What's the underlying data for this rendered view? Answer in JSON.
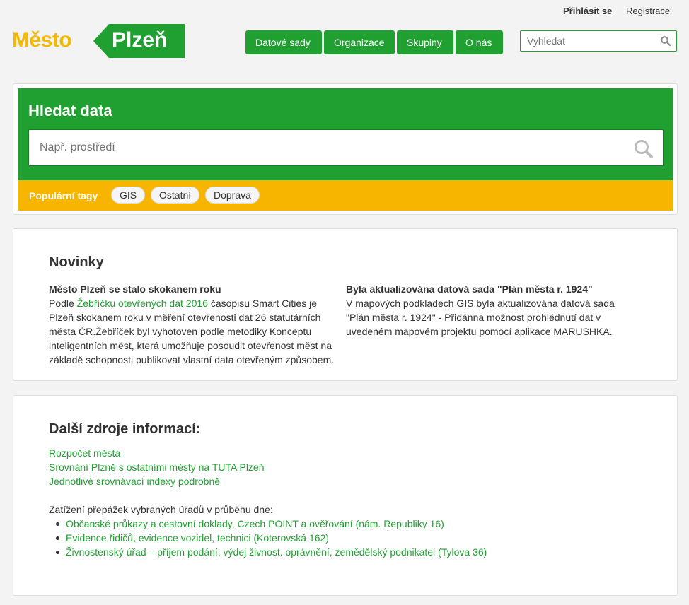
{
  "header": {
    "login_label": "Přihlásit se",
    "register_label": "Registrace",
    "logo": {
      "part1": "Město",
      "part2": "Plzeň"
    },
    "nav": [
      {
        "label": "Datové sady"
      },
      {
        "label": "Organizace"
      },
      {
        "label": "Skupiny"
      },
      {
        "label": "O nás"
      }
    ],
    "search": {
      "placeholder": "Vyhledat",
      "icon": "search-icon"
    }
  },
  "hero": {
    "title": "Hledat data",
    "search": {
      "placeholder": "Např. prostředí",
      "icon": "search-icon"
    },
    "tags_label": "Populární tagy",
    "tags": [
      "GIS",
      "Ostatní",
      "Doprava"
    ]
  },
  "news": {
    "title": "Novinky",
    "items": [
      {
        "title": "Město Plzeň se stalo skokanem roku",
        "text_before_link": "Podle ",
        "link_text": "Žebříčku otevřených dat 2016",
        "text_after_link": " časopisu Smart Cities je Plzeň skokanem roku v měření otevřenosti dat 26 statutárních města ČR.Žebříček byl vyhotoven podle metodiky Konceptu inteligentních měst, která umožňuje posoudit otevřenost měst na základě schopnosti publikovat vlastní data otevřeným způsobem."
      },
      {
        "title": "Byla aktualizována datová sada \"Plán města r. 1924\"",
        "text": "V mapových podkladech GIS byla aktualizována datová sada \"Plán města r. 1924\" - Přidánna možnost prohlédnutí dat v uvedeném mapovém projektu pomocí aplikace MARUSHKA."
      }
    ]
  },
  "resources": {
    "title": "Další zdroje informací:",
    "links": [
      "Rozpočet města",
      "Srovnání Plzně s ostatními městy na TUTA Plzeň",
      "Jednotlivé srovnávací indexy podrobně"
    ],
    "note": "Zatížení přepážek vybraných úřadů v průběhu dne:",
    "offices": [
      "Občanské průkazy a cestovní doklady, Czech POINT a ověřování (nám. Republiky 16)",
      "Evidence řidičů, evidence vozidel, technici (Koterovská 162)",
      "Živnostenský úřad – příjem podání, výdej živnost. oprávnění, zemědělský podnikatel (Tylova 36)"
    ]
  },
  "colors": {
    "brand_green": "#21a032",
    "brand_yellow": "#f8b500",
    "logo_yellow": "#f5b800",
    "background": "#f3f3f3"
  }
}
